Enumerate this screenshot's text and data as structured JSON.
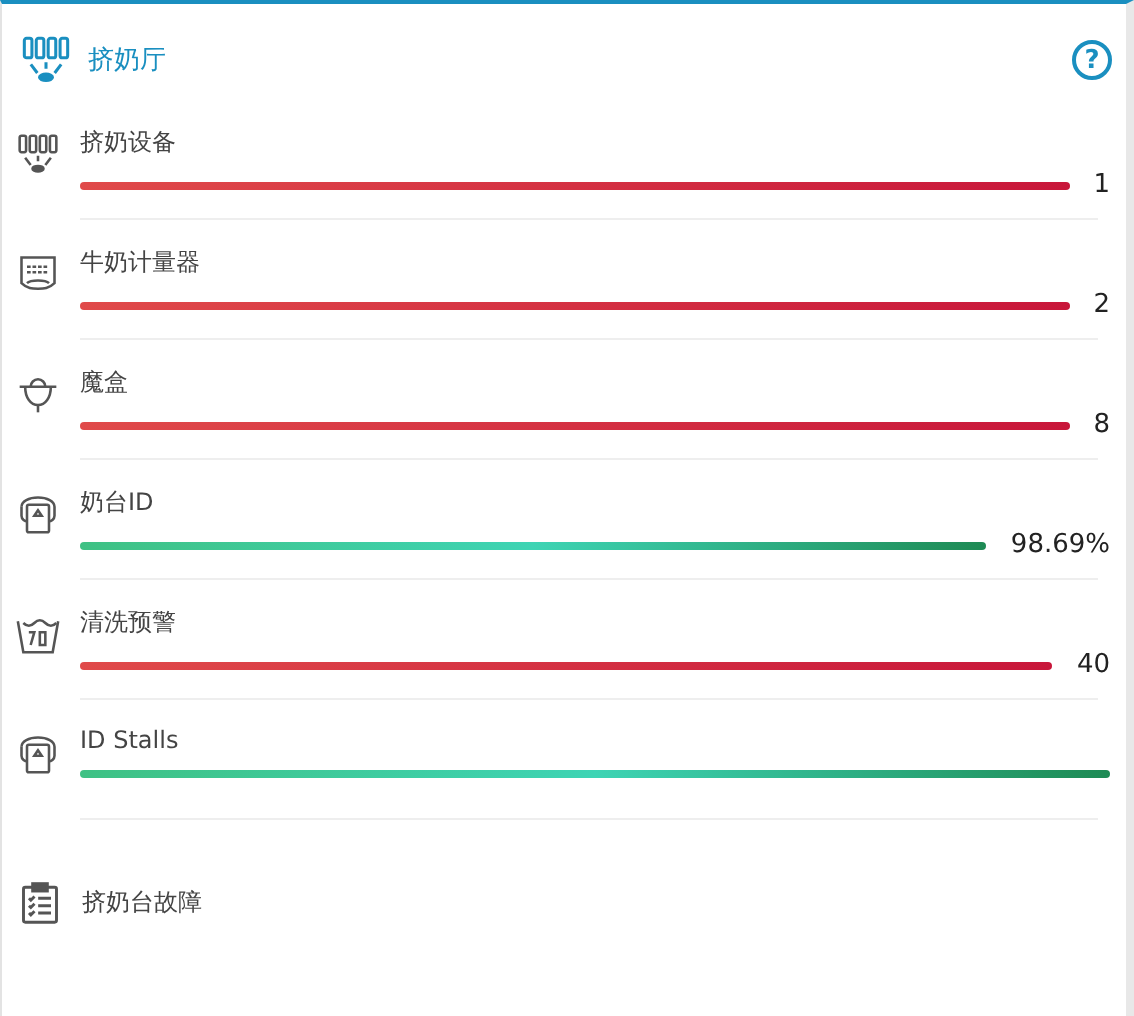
{
  "panel": {
    "title": "挤奶厅",
    "help": "?"
  },
  "items": [
    {
      "kind": "cups",
      "label": "挤奶设备",
      "value": "1",
      "alarm": true
    },
    {
      "kind": "meter",
      "label": "牛奶计量器",
      "value": "2",
      "alarm": true
    },
    {
      "kind": "box",
      "label": "魔盒",
      "value": "8",
      "alarm": true
    },
    {
      "kind": "tag",
      "label": "奶台ID",
      "value": "98.69%",
      "alarm": false
    },
    {
      "kind": "wash",
      "label": "清洗预警",
      "value": "40",
      "alarm": true
    },
    {
      "kind": "tag",
      "label": "ID Stalls",
      "alarm": false
    }
  ],
  "footer_item": {
    "kind": "clipboard",
    "label": "挤奶台故障"
  }
}
